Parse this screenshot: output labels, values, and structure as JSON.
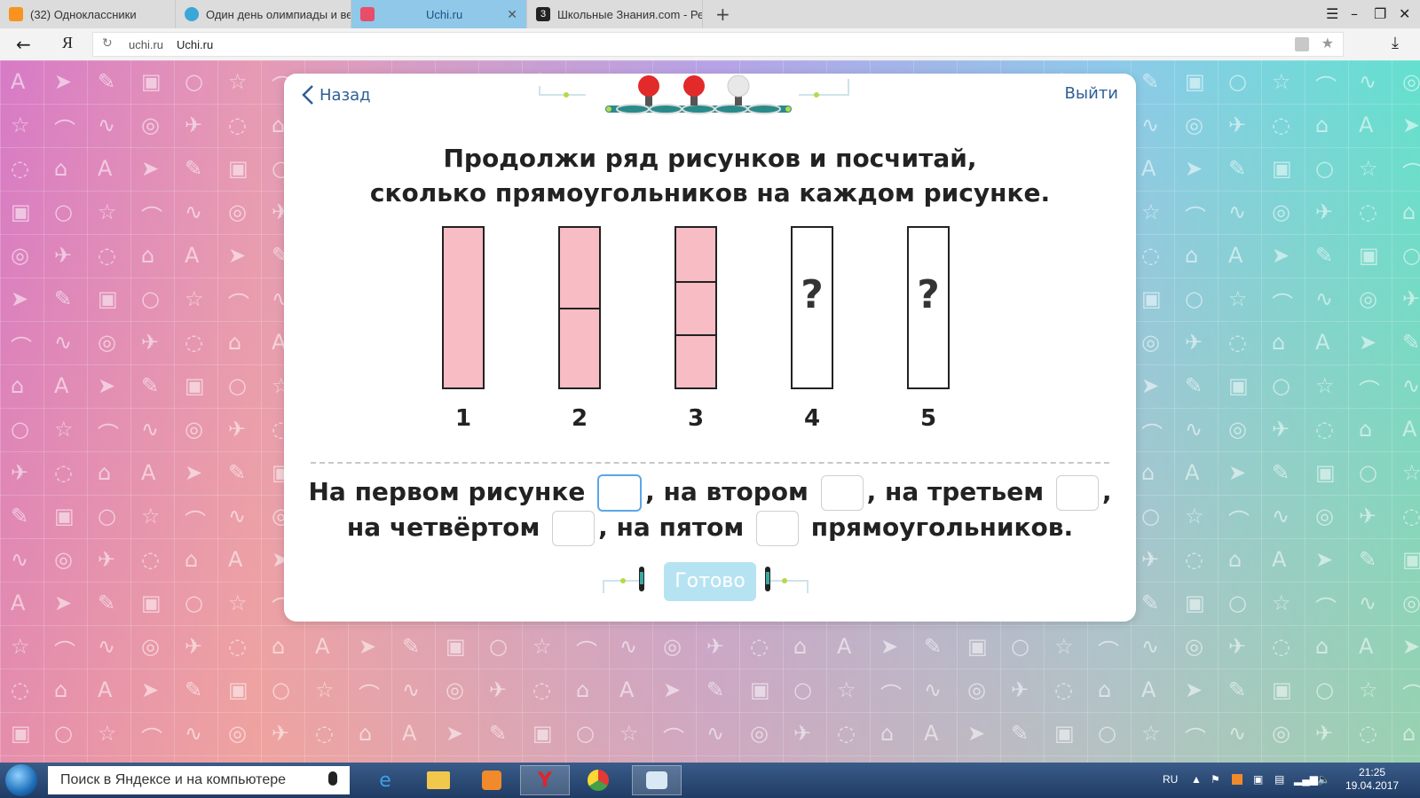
{
  "tabs": [
    {
      "title": "(32) Одноклассники",
      "active": false,
      "favicon_color": "#f7931e"
    },
    {
      "title": "Один день олимпиады и ве",
      "active": false,
      "favicon_color": "#3aa7d9"
    },
    {
      "title": "Uchi.ru",
      "active": true,
      "favicon_color": "#e84d6a"
    },
    {
      "title": "Школьные Знания.com - Ре",
      "active": false,
      "favicon_color": "#222222"
    }
  ],
  "address": {
    "domain": "uchi.ru",
    "page_title": "Uchi.ru"
  },
  "modal": {
    "back_label": "Назад",
    "exit_label": "Выйти",
    "title_line1": "Продолжи ряд рисунков и посчитай,",
    "title_line2": "сколько прямоугольников на каждом рисунке.",
    "figures": [
      {
        "label": "1",
        "segments": 1,
        "unknown": false
      },
      {
        "label": "2",
        "segments": 2,
        "unknown": false
      },
      {
        "label": "3",
        "segments": 3,
        "unknown": false
      },
      {
        "label": "4",
        "segments": 0,
        "unknown": true
      },
      {
        "label": "5",
        "segments": 0,
        "unknown": true
      }
    ],
    "question_mark": "?",
    "answer": {
      "first": "На первом рисунке",
      "second": ", на втором",
      "third": ", на третьем",
      "comma": ",",
      "fourth": "на четвёртом",
      "fifth": ", на пятом",
      "end": "прямоугольников."
    },
    "ready_label": "Готово"
  },
  "colors": {
    "fill": "#f7bcc4",
    "accent": "#2d5f96",
    "ready_bg": "#b6e3f2",
    "lamp_on": "#e22a2a",
    "lamp_off": "#e8e8e8"
  },
  "taskbar": {
    "search_placeholder": "Поиск в Яндексе и на компьютере",
    "lang": "RU",
    "time": "21:25",
    "date": "19.04.2017"
  }
}
